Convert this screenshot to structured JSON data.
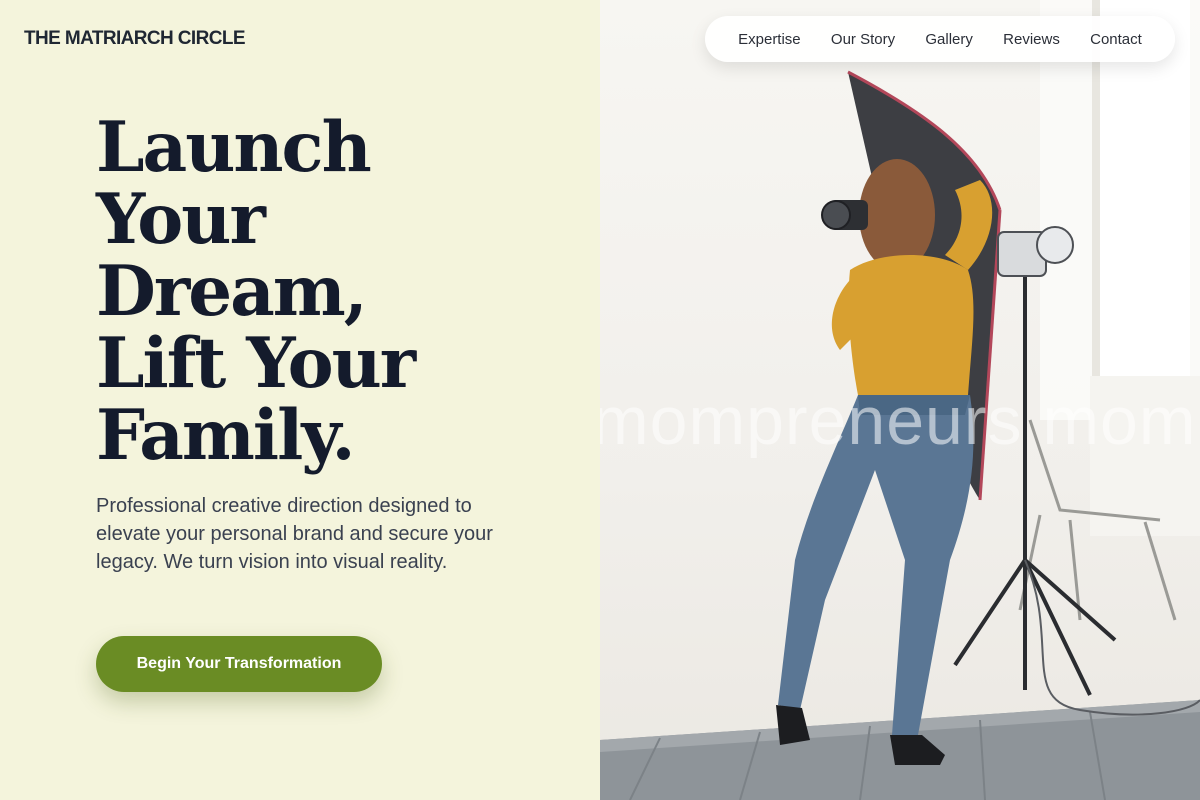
{
  "brand": {
    "name": "THE MATRIARCH CIRCLE"
  },
  "nav": {
    "items": [
      {
        "label": "Expertise"
      },
      {
        "label": "Our Story"
      },
      {
        "label": "Gallery"
      },
      {
        "label": "Reviews"
      },
      {
        "label": "Contact"
      }
    ]
  },
  "hero": {
    "title_lines": [
      "Launch",
      "Your",
      "Dream,",
      "Lift Your",
      "Family."
    ],
    "subtitle": "Professional creative direction designed to elevate your personal brand and secure your legacy. We turn vision into visual reality.",
    "cta_label": "Begin Your Transformation"
  },
  "photo": {
    "watermark": "mompreneurs mom"
  },
  "colors": {
    "background": "#f4f4dc",
    "accent": "#6a8c24",
    "heading": "#141b2c"
  }
}
